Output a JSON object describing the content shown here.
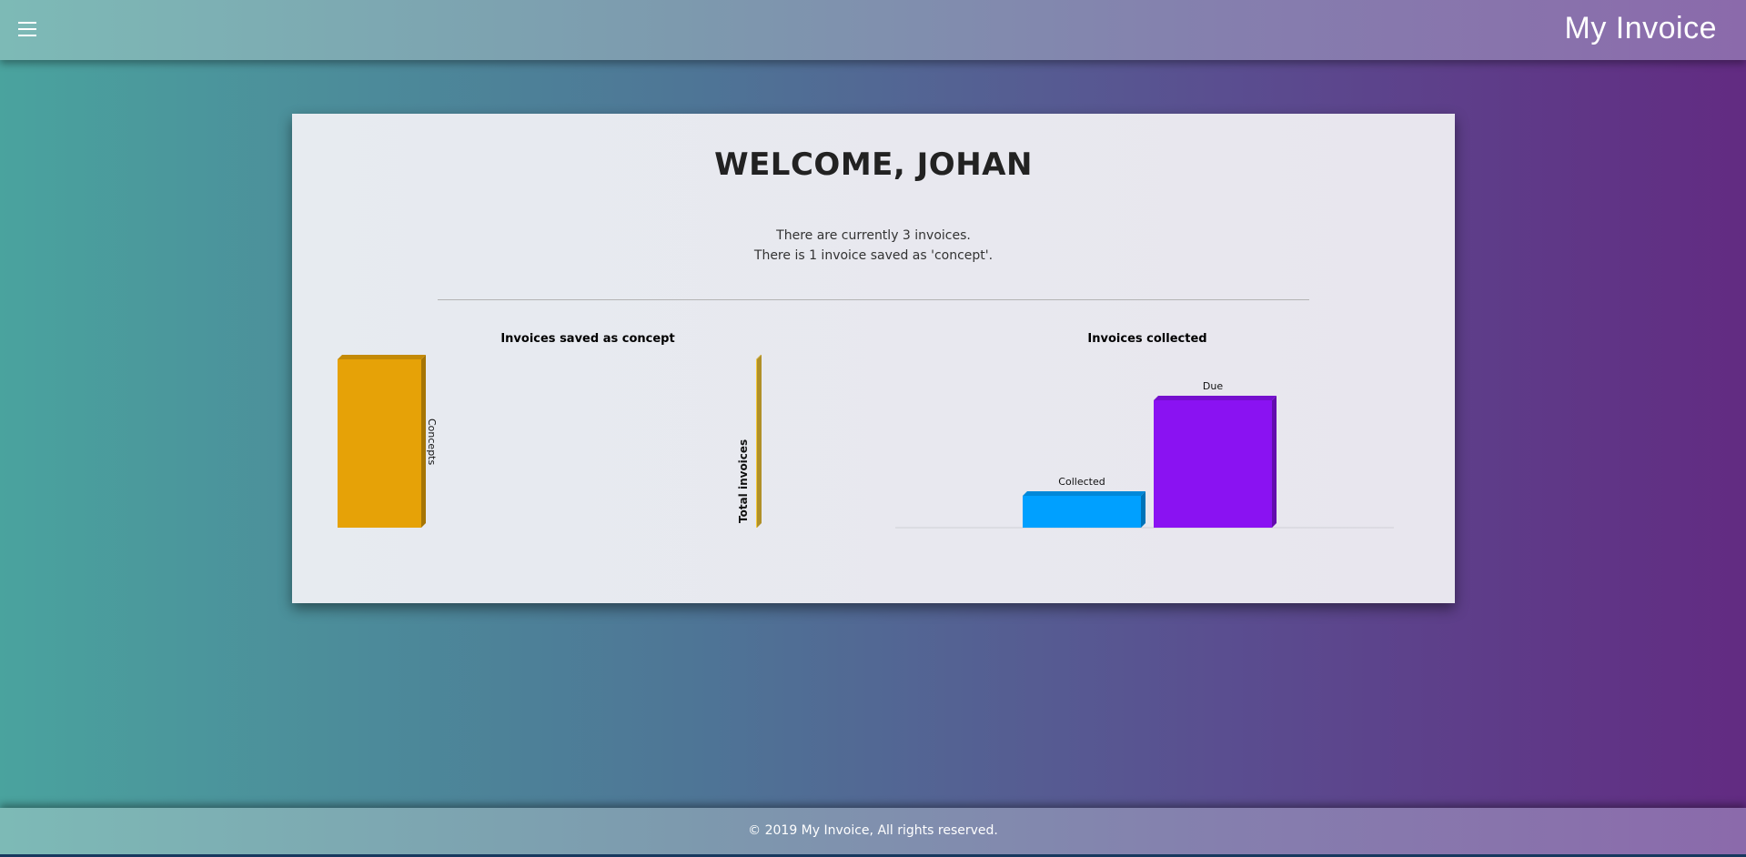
{
  "header": {
    "menu_icon": "hamburger-menu-icon",
    "app_title": "My Invoice"
  },
  "welcome": {
    "title": "WELCOME, JOHAN",
    "line1": "There are currently 3 invoices.",
    "line2": "There is 1 invoice saved as 'concept'."
  },
  "colors": {
    "concepts_bar": "#e6a207",
    "total_bar": "#f5c838",
    "collected_bar": "#00a0ff",
    "due_bar": "#8a12f2"
  },
  "chart_data": [
    {
      "type": "bar",
      "title": "Invoices saved as concept",
      "series": [
        {
          "name": "Concepts",
          "values": [
            1
          ]
        },
        {
          "name": "Total invoices",
          "values": [
            3
          ]
        }
      ]
    },
    {
      "type": "bar",
      "title": "Invoices collected",
      "categories": [
        "Collected",
        "Due"
      ],
      "values": [
        1,
        4
      ]
    }
  ],
  "footer": {
    "text": "© 2019 My Invoice, All rights reserved."
  }
}
